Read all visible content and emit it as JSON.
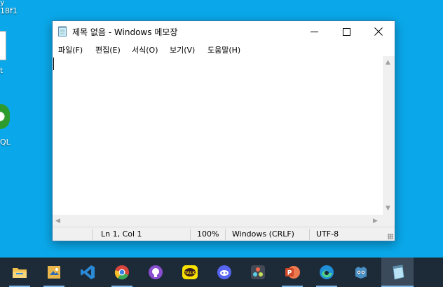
{
  "desktop": {
    "icons": [
      {
        "label_line1": "y",
        "label_line2": "18f1"
      },
      {
        "label": "t"
      },
      {
        "label": "QL"
      }
    ]
  },
  "window": {
    "title": "제목 없음 - Windows 메모장",
    "app_icon": "notepad-icon",
    "menu": [
      "파일(F)",
      "편집(E)",
      "서식(O)",
      "보기(V)",
      "도움말(H)"
    ],
    "editor_text": "",
    "status": {
      "position": "Ln 1, Col 1",
      "zoom": "100%",
      "line_ending": "Windows (CRLF)",
      "encoding": "UTF-8"
    }
  },
  "taskbar": {
    "apps": [
      {
        "name": "file-explorer-icon",
        "color": "#f2c14e"
      },
      {
        "name": "image-editor-icon",
        "color": "#e8b64a"
      },
      {
        "name": "vscode-icon",
        "color": "#2a8ad6"
      },
      {
        "name": "chrome-icon",
        "color": "#d9463b"
      },
      {
        "name": "github-desktop-icon",
        "color": "#8a4fd1"
      },
      {
        "name": "kakaotalk-icon",
        "color": "#f8e100",
        "text": "TALK"
      },
      {
        "name": "discord-icon",
        "color": "#5865f2"
      },
      {
        "name": "davinci-resolve-icon",
        "color": "#444a55"
      },
      {
        "name": "powerpoint-icon",
        "color": "#d04a2a"
      },
      {
        "name": "edge-icon",
        "color": "#1f8fd8"
      },
      {
        "name": "godot-icon",
        "color": "#4a8fc4"
      },
      {
        "name": "notepad-icon",
        "color": "#b9e3f5"
      }
    ],
    "active_index": 11
  }
}
